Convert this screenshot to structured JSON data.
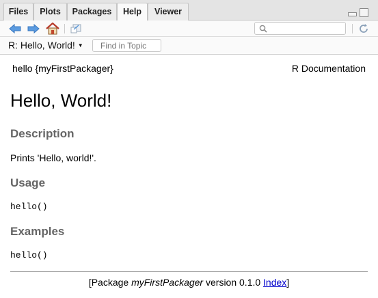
{
  "tabs": [
    {
      "label": "Files"
    },
    {
      "label": "Plots"
    },
    {
      "label": "Packages"
    },
    {
      "label": "Help",
      "active": true
    },
    {
      "label": "Viewer"
    }
  ],
  "toolbar": {
    "icons": [
      "back-arrow-icon",
      "forward-arrow-icon",
      "home-icon",
      "open-in-new-window-icon",
      "search-icon",
      "refresh-icon"
    ],
    "search_placeholder": "",
    "accent_color": "#4a8fd6"
  },
  "topicbar": {
    "topic": "R: Hello, World!",
    "find_placeholder": "Find in Topic"
  },
  "doc": {
    "header_left": "hello {myFirstPackager}",
    "header_right": "R Documentation",
    "title": "Hello, World!",
    "sections": [
      {
        "heading": "Description",
        "body": "Prints 'Hello, world!'."
      },
      {
        "heading": "Usage",
        "code": "hello()"
      },
      {
        "heading": "Examples",
        "code": "hello()"
      }
    ],
    "footer": {
      "prefix": "[Package ",
      "package": "myFirstPackager",
      "middle": " version 0.1.0 ",
      "link": "Index",
      "suffix": "]"
    }
  }
}
